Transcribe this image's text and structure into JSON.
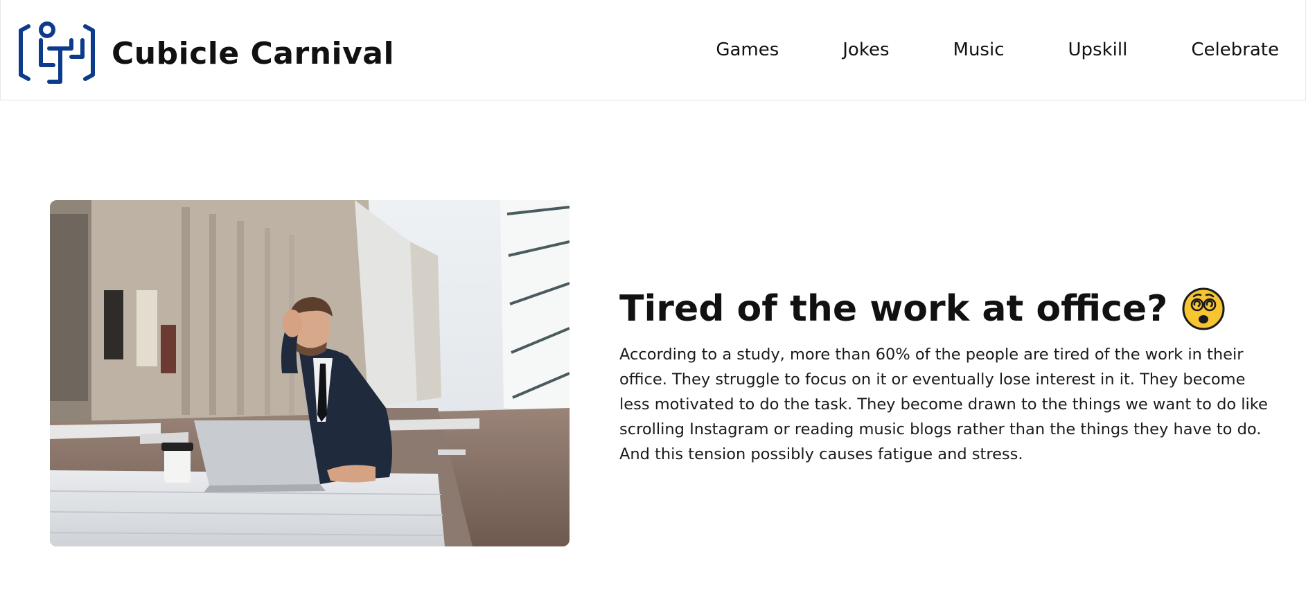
{
  "brand": {
    "name": "Cubicle Carnival",
    "logo_icon": "cubicle-worker-icon",
    "logo_color": "#0d3b8c"
  },
  "nav": {
    "items": [
      {
        "label": "Games"
      },
      {
        "label": "Jokes"
      },
      {
        "label": "Music"
      },
      {
        "label": "Upskill"
      },
      {
        "label": "Celebrate"
      }
    ]
  },
  "hero": {
    "image_icon": "tired-office-worker-photo",
    "title": "Tired of the work at office?",
    "title_emoji_icon": "dizzy-face-emoji-icon",
    "body": "According to a study, more than 60% of the people are tired of the work in their office. They struggle to focus on it or eventually lose interest in it. They become less motivated to do the task. They become drawn to the things we want to do like scrolling Instagram or reading music blogs rather than the things they have to do. And this tension possibly causes fatigue and stress."
  }
}
